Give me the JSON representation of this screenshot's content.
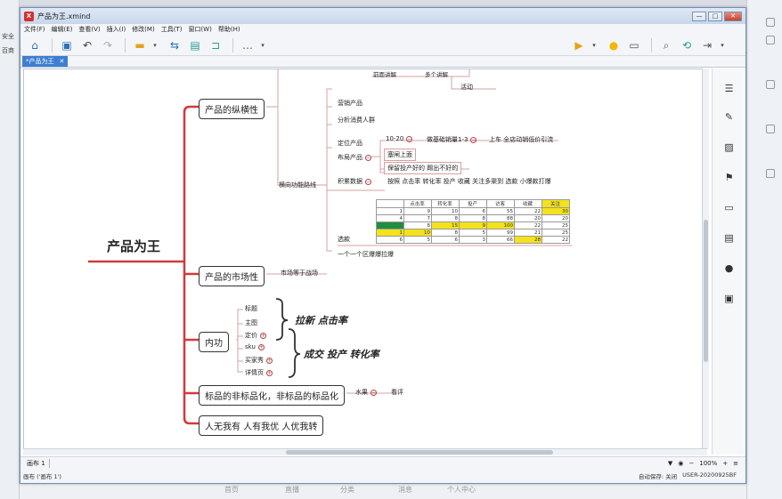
{
  "window": {
    "title": "产品为王.xmind",
    "app_badge": "X",
    "controls": {
      "minimize": "—",
      "maximize": "□",
      "close": "✕"
    }
  },
  "menu": [
    "文件(F)",
    "编辑(E)",
    "查看(V)",
    "插入(I)",
    "修改(M)",
    "工具(T)",
    "窗口(W)",
    "帮助(H)"
  ],
  "tab": {
    "label": "*产品为王",
    "close": "✕"
  },
  "background": {
    "left_labels": [
      "安全",
      "百商"
    ],
    "bottom_labels": [
      "首页",
      "直播",
      "分类",
      "消息",
      "个人中心"
    ]
  },
  "map": {
    "central": "产品为王",
    "main": {
      "vertical": "产品的纵横性",
      "market": "产品的市场性",
      "internal": "内功",
      "standard": "标品的非标品化，非标品的标品化",
      "unique": "人无我有 人有我优 人优我转"
    },
    "vertical_children": {
      "top_hidden": "前面讲解",
      "top_hidden2": "多个讲解",
      "activity": "活动",
      "marketing": "营销产品",
      "consumer": "分析消费人群",
      "route": "横向功能路线",
      "positioning": "定位产品",
      "layout": "布局产品",
      "sales_range": "10-20",
      "sales_basic": "做基础销量1-3",
      "traffic": "上车 全店动销低价引流",
      "upper": "塞闸上面",
      "keep_good": "保留投产好的 踢出不好的",
      "accumulate": "积累数据",
      "metrics": "按照 点击率 转化率 投产 收藏 关注多渠到 选款 小爆款打爆",
      "select": "选款",
      "traffic_pull": "一个一个区爆爆拉爆"
    },
    "market_children": {
      "market_level": "市场等于战场"
    },
    "internal_children": {
      "items": [
        "标题",
        "主图",
        "定价",
        "sku",
        "买家秀",
        "详情页"
      ],
      "note1": "拉新 点击率",
      "note2": "成交 投产 转化率"
    },
    "standard_children": {
      "fruit": "水果",
      "tea": "看评"
    }
  },
  "table": {
    "headers": [
      "",
      "点击率",
      "转化率",
      "投产",
      "访客",
      "收藏",
      "关注"
    ],
    "rows": [
      [
        "1",
        "9",
        "10",
        "6",
        "55",
        "22",
        "30"
      ],
      [
        "4",
        "7",
        "8",
        "8",
        "88",
        "20",
        "20"
      ],
      [
        "",
        "8",
        "15",
        "9",
        "100",
        "22",
        "25"
      ],
      [
        "1",
        "10",
        "8",
        "5",
        "99",
        "21",
        "25"
      ],
      [
        "6",
        "5",
        "6",
        "3",
        "66",
        "28",
        "22"
      ]
    ]
  },
  "sheet": {
    "tab": "画布 1"
  },
  "zoom": {
    "value": "100%",
    "minus": "−",
    "plus": "+"
  },
  "status": {
    "left": "画布 ('画布 1')",
    "autosave": "自动保存: 关闭",
    "user": "USER-20200925BF"
  }
}
